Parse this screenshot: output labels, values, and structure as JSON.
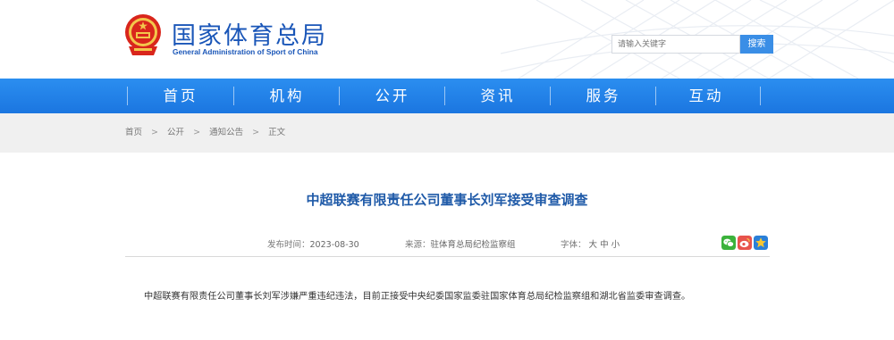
{
  "header": {
    "site_name": "国家体育总局",
    "site_sub": "General Administration of Sport of China",
    "search_placeholder": "请输入关键字",
    "search_button": "搜索"
  },
  "nav": {
    "items": [
      {
        "label": "首页"
      },
      {
        "label": "机构"
      },
      {
        "label": "公开"
      },
      {
        "label": "资讯"
      },
      {
        "label": "服务"
      },
      {
        "label": "互动"
      }
    ]
  },
  "breadcrumb": {
    "items": [
      "首页",
      "公开",
      "通知公告",
      "正文"
    ],
    "separator": ">"
  },
  "article": {
    "title": "中超联赛有限责任公司董事长刘军接受审查调查",
    "publish_label": "发布时间：",
    "publish_date": "2023-08-30",
    "source_label": "来源：",
    "source": "驻体育总局纪检监察组",
    "font_label": "字体：",
    "font_large": "大",
    "font_medium": "中",
    "font_small": "小",
    "body": "中超联赛有限责任公司董事长刘军涉嫌严重违纪违法，目前正接受中央纪委国家监委驻国家体育总局纪检监察组和湖北省监委审查调查。"
  },
  "share": [
    {
      "icon": "wechat-icon",
      "color": "#3bb23b"
    },
    {
      "icon": "weibo-icon",
      "color": "#e8534c"
    },
    {
      "icon": "qzone-icon",
      "color": "#2a7fd8"
    }
  ],
  "colors": {
    "brand_blue": "#1a56b8",
    "nav_blue": "#1b76e0",
    "title_blue": "#1f5aa8",
    "search_button": "#3a8ee6"
  }
}
